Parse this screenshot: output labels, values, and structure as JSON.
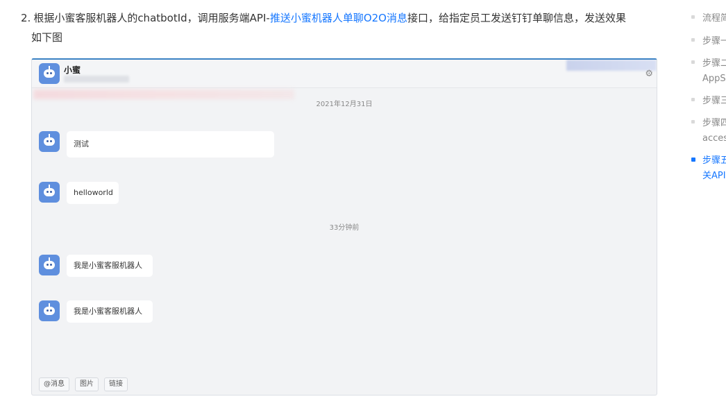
{
  "doc": {
    "item_number": "2.",
    "text_before": "根据小蜜客服机器人的chatbotId，调用服务端API-",
    "link_text": "推送小蜜机器人单聊O2O消息",
    "text_after": "接口，给指定员工发送钉钉单聊信息，发送效果",
    "text_line2": "如下图"
  },
  "chat": {
    "name": "小蜜",
    "settings_icon": "gear-icon",
    "avatar_icon": "robot-icon",
    "date_1": "2021年12月31日",
    "date_2": "33分钟前",
    "messages": [
      {
        "text": "测试"
      },
      {
        "text": "helloworld"
      },
      {
        "text": "我是小蜜客服机器人"
      },
      {
        "text": "我是小蜜客服机器人"
      }
    ],
    "toolbar": [
      "@消息",
      "图片",
      "链接"
    ]
  },
  "toc": {
    "items": [
      {
        "text": "流程简"
      },
      {
        "text": "步骤一"
      },
      {
        "text": "步骤二"
      },
      {
        "text": "AppS"
      },
      {
        "text": "步骤三"
      },
      {
        "text": "步骤四"
      },
      {
        "text": "acces"
      },
      {
        "text": "步骤五"
      },
      {
        "text": "关API"
      }
    ],
    "active_color": "#1677ff"
  }
}
